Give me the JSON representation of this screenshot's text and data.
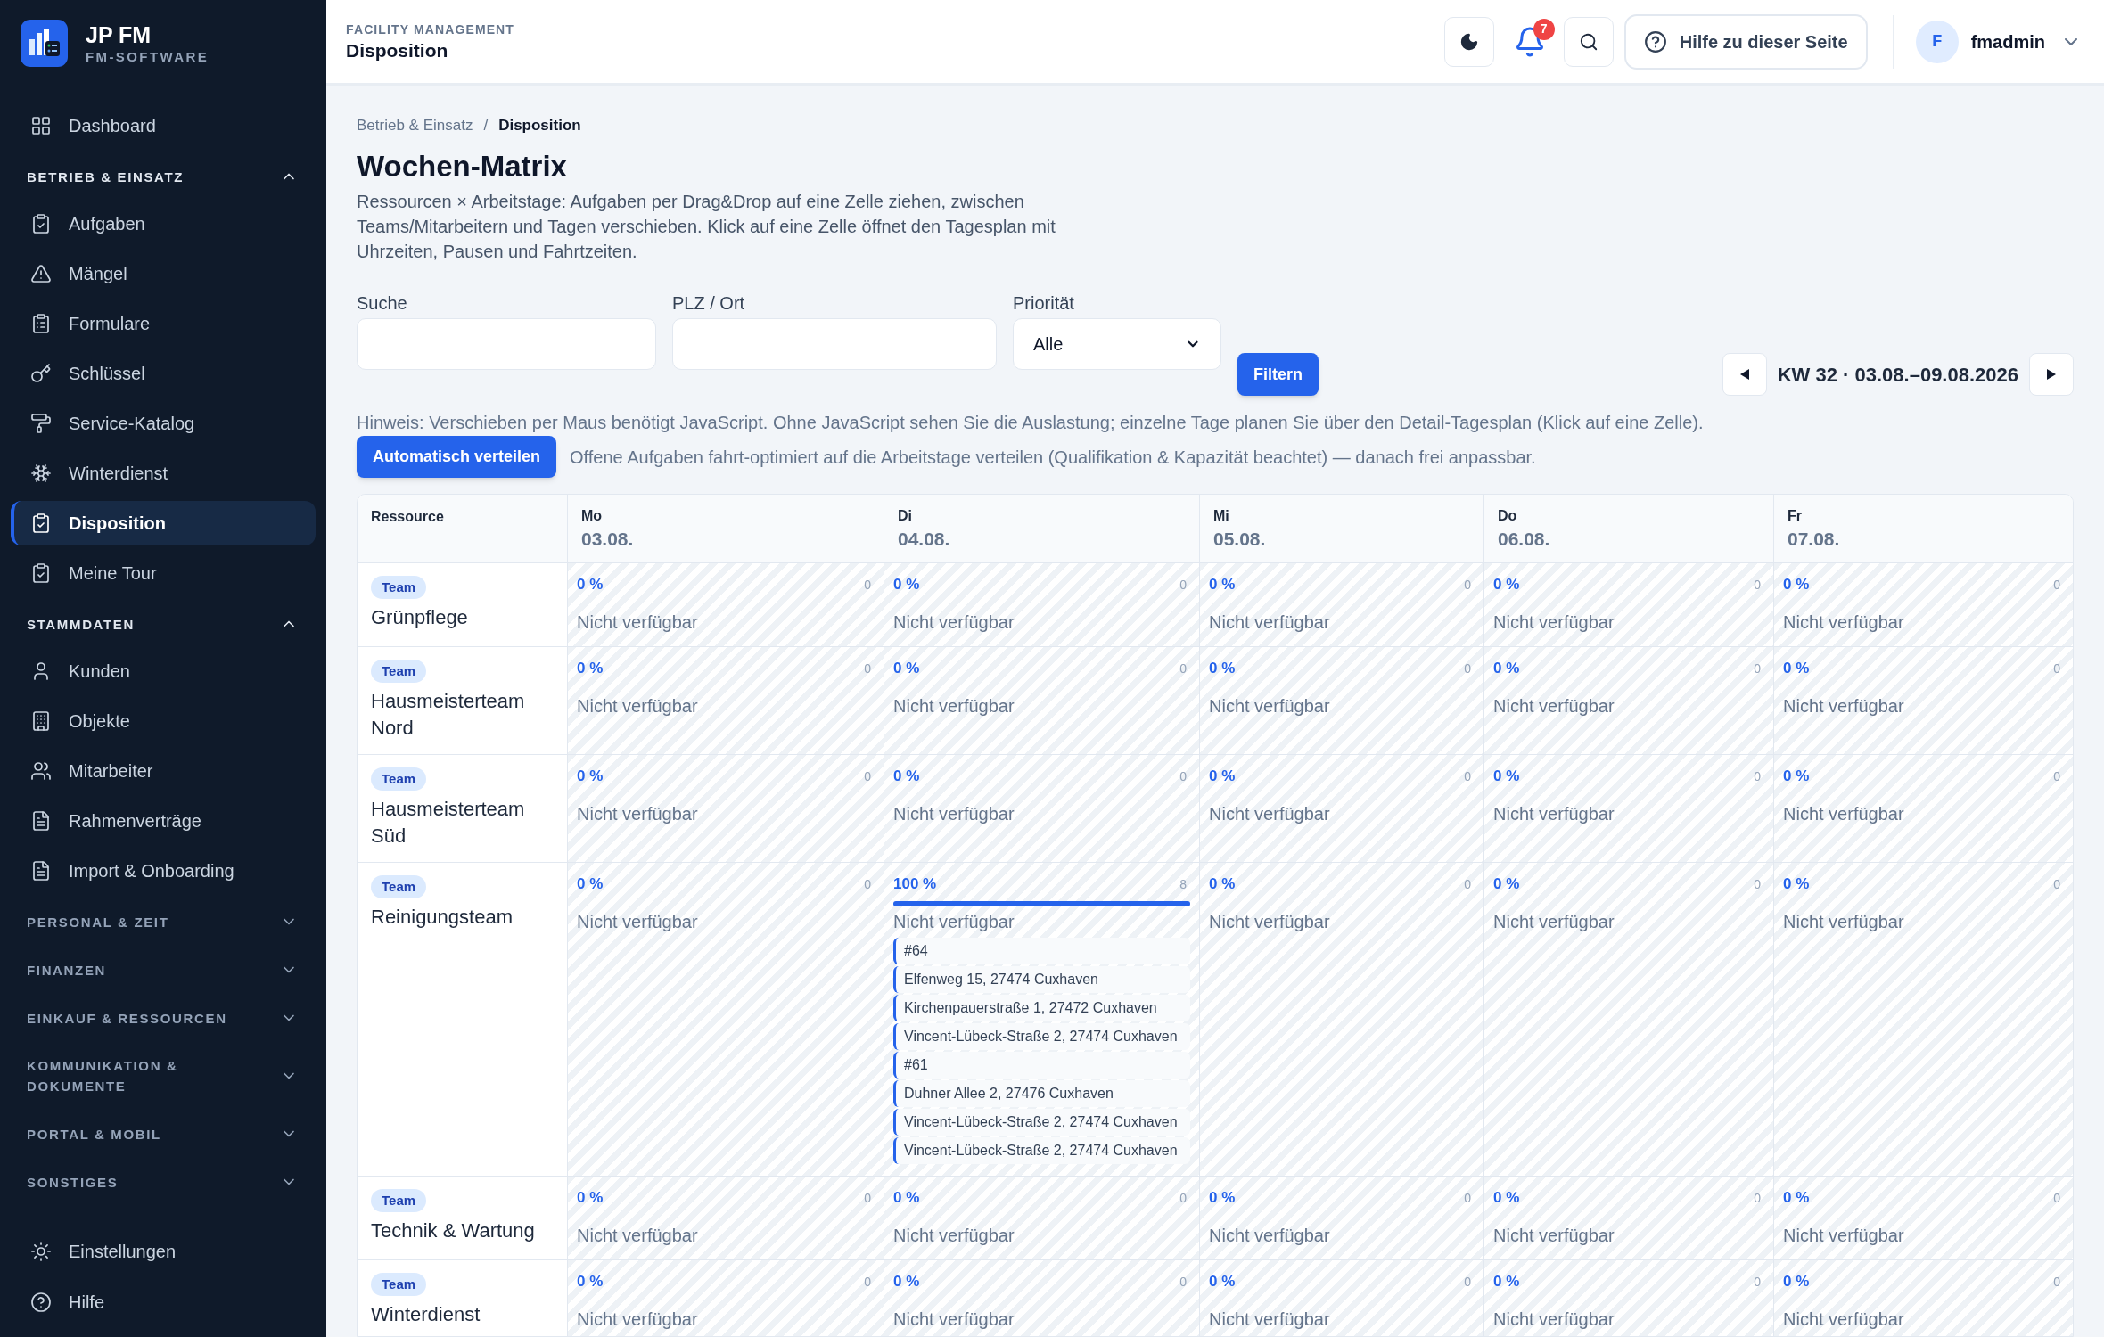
{
  "brand": {
    "name": "JP FM",
    "subtitle": "FM-SOFTWARE"
  },
  "sidebar": {
    "items": [
      {
        "kind": "link",
        "label": "Dashboard",
        "selected": false
      },
      {
        "kind": "section",
        "label": "BETRIEB & EINSATZ",
        "expanded": true,
        "children": [
          {
            "label": "Aufgaben",
            "selected": false
          },
          {
            "label": "Mängel",
            "selected": false
          },
          {
            "label": "Formulare",
            "selected": false
          },
          {
            "label": "Schlüssel",
            "selected": false
          },
          {
            "label": "Service-Katalog",
            "selected": false
          },
          {
            "label": "Winterdienst",
            "selected": false
          },
          {
            "label": "Disposition",
            "selected": true
          },
          {
            "label": "Meine Tour",
            "selected": false
          }
        ]
      },
      {
        "kind": "section",
        "label": "STAMMDATEN",
        "expanded": true,
        "children": [
          {
            "label": "Kunden",
            "selected": false
          },
          {
            "label": "Objekte",
            "selected": false
          },
          {
            "label": "Mitarbeiter",
            "selected": false
          },
          {
            "label": "Rahmenverträge",
            "selected": false
          },
          {
            "label": "Import & Onboarding",
            "selected": false
          }
        ]
      },
      {
        "kind": "section",
        "label": "PERSONAL & ZEIT",
        "expanded": false
      },
      {
        "kind": "section",
        "label": "FINANZEN",
        "expanded": false
      },
      {
        "kind": "section",
        "label": "EINKAUF & RESSOURCEN",
        "expanded": false
      },
      {
        "kind": "section",
        "label": "KOMMUNIKATION & DOKUMENTE",
        "expanded": false
      },
      {
        "kind": "section",
        "label": "PORTAL & MOBIL",
        "expanded": false
      },
      {
        "kind": "section",
        "label": "SONSTIGES",
        "expanded": false
      }
    ],
    "footer": [
      {
        "label": "Einstellungen"
      },
      {
        "label": "Hilfe"
      }
    ]
  },
  "header": {
    "overline": "FACILITY MANAGEMENT",
    "title": "Disposition",
    "notifications": "7",
    "help": "Hilfe zu dieser Seite",
    "avatar": "F",
    "user": "fmadmin"
  },
  "breadcrumb": {
    "items": [
      "Betrieb & Einsatz",
      "Disposition"
    ],
    "separator": "/"
  },
  "page": {
    "title": "Wochen-Matrix",
    "description": "Ressourcen × Arbeitstage: Aufgaben per Drag&Drop auf eine Zelle ziehen, zwischen Teams/Mitarbeitern und Tagen verschieben. Klick auf eine Zelle öffnet den Tagesplan mit Uhrzeiten, Pausen und Fahrtzeiten."
  },
  "filters": {
    "fields": [
      {
        "label": "Suche"
      },
      {
        "label": "PLZ / Ort"
      }
    ],
    "priority": {
      "label": "Priorität",
      "value": "Alle"
    },
    "button": "Filtern"
  },
  "week": {
    "label": "KW 32 · 03.08.–09.08.2026"
  },
  "hint": "Hinweis: Verschieben per Maus benötigt JavaScript. Ohne JavaScript sehen Sie die Auslastung; einzelne Tage planen Sie über den Detail-Tagesplan (Klick auf eine Zelle).",
  "auto": {
    "button": "Automatisch verteilen",
    "description": "Offene Aufgaben fahrt-optimiert auf die Arbeitstage verteilen (Qualifikation & Kapazität beachtet) — danach frei anpassbar."
  },
  "table": {
    "resource_header": "Ressource",
    "columns": [
      {
        "day": "Mo",
        "date": "03.08."
      },
      {
        "day": "Di",
        "date": "04.08."
      },
      {
        "day": "Mi",
        "date": "05.08."
      },
      {
        "day": "Do",
        "date": "06.08."
      },
      {
        "day": "Fr",
        "date": "07.08."
      }
    ],
    "rows": [
      {
        "tag": "Team",
        "name": "Grünpflege",
        "cells": [
          {
            "percent": "0 %",
            "capacity": "0",
            "status": "Nicht verfügbar"
          },
          {
            "percent": "0 %",
            "capacity": "0",
            "status": "Nicht verfügbar"
          },
          {
            "percent": "0 %",
            "capacity": "0",
            "status": "Nicht verfügbar"
          },
          {
            "percent": "0 %",
            "capacity": "0",
            "status": "Nicht verfügbar"
          },
          {
            "percent": "0 %",
            "capacity": "0",
            "status": "Nicht verfügbar"
          }
        ]
      },
      {
        "tag": "Team",
        "name": "Hausmeisterteam Nord",
        "cells": [
          {
            "percent": "0 %",
            "capacity": "0",
            "status": "Nicht verfügbar"
          },
          {
            "percent": "0 %",
            "capacity": "0",
            "status": "Nicht verfügbar"
          },
          {
            "percent": "0 %",
            "capacity": "0",
            "status": "Nicht verfügbar"
          },
          {
            "percent": "0 %",
            "capacity": "0",
            "status": "Nicht verfügbar"
          },
          {
            "percent": "0 %",
            "capacity": "0",
            "status": "Nicht verfügbar"
          }
        ]
      },
      {
        "tag": "Team",
        "name": "Hausmeisterteam Süd",
        "cells": [
          {
            "percent": "0 %",
            "capacity": "0",
            "status": "Nicht verfügbar"
          },
          {
            "percent": "0 %",
            "capacity": "0",
            "status": "Nicht verfügbar"
          },
          {
            "percent": "0 %",
            "capacity": "0",
            "status": "Nicht verfügbar"
          },
          {
            "percent": "0 %",
            "capacity": "0",
            "status": "Nicht verfügbar"
          },
          {
            "percent": "0 %",
            "capacity": "0",
            "status": "Nicht verfügbar"
          }
        ]
      },
      {
        "tag": "Team",
        "name": "Reinigungsteam",
        "cells": [
          {
            "percent": "0 %",
            "capacity": "0",
            "status": "Nicht verfügbar"
          },
          {
            "percent": "100 %",
            "capacity": "8",
            "level": 1,
            "status": "Nicht verfügbar",
            "tasks": [
              "#64",
              "Elfenweg 15, 27474 Cuxhaven",
              "Kirchenpauerstraße 1, 27472 Cuxhaven",
              "Vincent-Lübeck-Straße 2, 27474 Cuxhaven",
              "#61",
              "Duhner Allee 2, 27476 Cuxhaven",
              "Vincent-Lübeck-Straße 2, 27474 Cuxhaven",
              "Vincent-Lübeck-Straße 2, 27474 Cuxhaven"
            ]
          },
          {
            "percent": "0 %",
            "capacity": "0",
            "status": "Nicht verfügbar"
          },
          {
            "percent": "0 %",
            "capacity": "0",
            "status": "Nicht verfügbar"
          },
          {
            "percent": "0 %",
            "capacity": "0",
            "status": "Nicht verfügbar"
          }
        ]
      },
      {
        "tag": "Team",
        "name": "Technik & Wartung",
        "cells": [
          {
            "percent": "0 %",
            "capacity": "0",
            "status": "Nicht verfügbar"
          },
          {
            "percent": "0 %",
            "capacity": "0",
            "status": "Nicht verfügbar"
          },
          {
            "percent": "0 %",
            "capacity": "0",
            "status": "Nicht verfügbar"
          },
          {
            "percent": "0 %",
            "capacity": "0",
            "status": "Nicht verfügbar"
          },
          {
            "percent": "0 %",
            "capacity": "0",
            "status": "Nicht verfügbar"
          }
        ]
      },
      {
        "tag": "Team",
        "name": "Winterdienst",
        "cells": [
          {
            "percent": "0 %",
            "capacity": "0",
            "status": "Nicht verfügbar"
          },
          {
            "percent": "0 %",
            "capacity": "0",
            "status": "Nicht verfügbar"
          },
          {
            "percent": "0 %",
            "capacity": "0",
            "status": "Nicht verfügbar"
          },
          {
            "percent": "0 %",
            "capacity": "0",
            "status": "Nicht verfügbar"
          },
          {
            "percent": "0 %",
            "capacity": "0",
            "status": "Nicht verfügbar"
          }
        ]
      }
    ]
  }
}
